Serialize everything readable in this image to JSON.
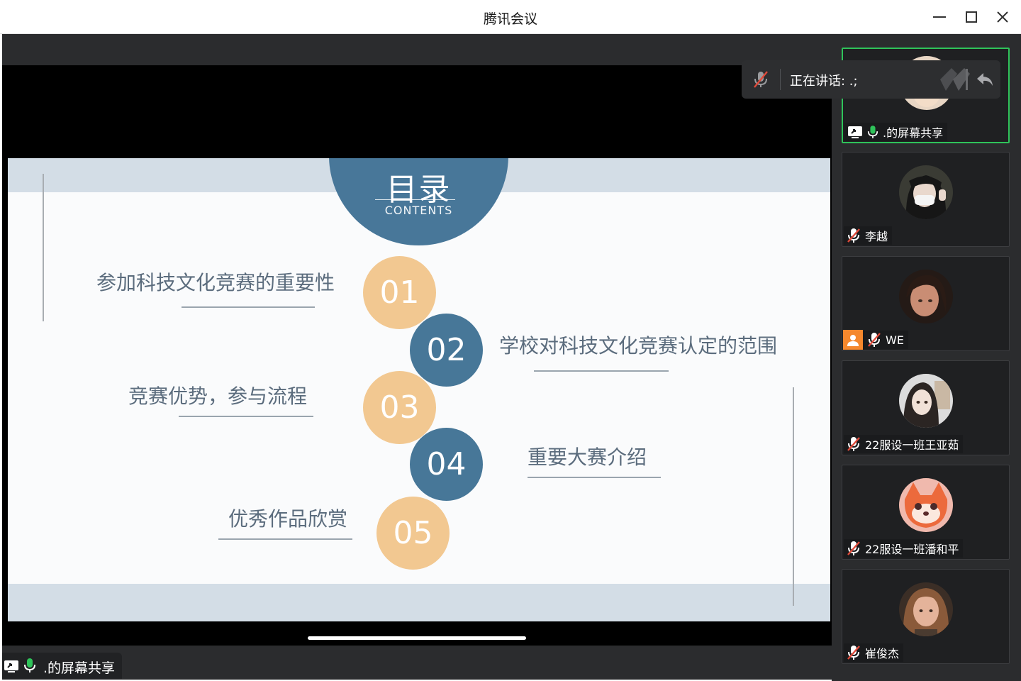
{
  "window": {
    "title": "腾讯会议"
  },
  "colors": {
    "accent_green": "#2fc35a",
    "slide_blue": "#477798",
    "slide_tan": "#f2c891",
    "muted_red": "#e04a3a"
  },
  "slide": {
    "title": "目录",
    "subtitle": "CONTENTS",
    "items": [
      {
        "num": "01",
        "text": "参加科技文化竞赛的重要性"
      },
      {
        "num": "02",
        "text": "学校对科技文化竞赛认定的范围"
      },
      {
        "num": "03",
        "text": "竞赛优势，参与流程"
      },
      {
        "num": "04",
        "text": "重要大赛介绍"
      },
      {
        "num": "05",
        "text": "优秀作品欣赏"
      }
    ]
  },
  "speaking_banner": {
    "text": "正在讲话: .;"
  },
  "main_share_label": {
    "text": ".的屏幕共享"
  },
  "participants": [
    {
      "name": ".的屏幕共享",
      "mic": "on",
      "sharing": true,
      "active": true,
      "avatar": "avatar-girl-light"
    },
    {
      "name": "李越",
      "mic": "muted",
      "avatar": "avatar-girl-mask"
    },
    {
      "name": "WE",
      "mic": "muted",
      "host": true,
      "avatar": "avatar-girl-dark-hair"
    },
    {
      "name": "22服设一班王亚茹",
      "mic": "muted",
      "avatar": "avatar-girl-photo"
    },
    {
      "name": "22服设一班潘和平",
      "mic": "muted",
      "avatar": "avatar-cartoon-fox"
    },
    {
      "name": "崔俊杰",
      "mic": "muted",
      "avatar": "avatar-girl-brown"
    }
  ]
}
